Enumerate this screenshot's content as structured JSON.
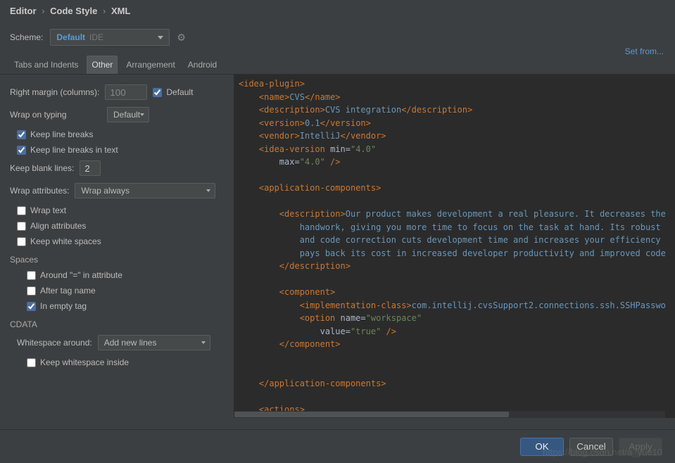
{
  "breadcrumb": {
    "p1": "Editor",
    "p2": "Code Style",
    "p3": "XML"
  },
  "scheme": {
    "label": "Scheme:",
    "name": "Default",
    "ide": "IDE"
  },
  "set_from": "Set from...",
  "tabs": {
    "t1": "Tabs and Indents",
    "t2": "Other",
    "t3": "Arrangement",
    "t4": "Android"
  },
  "left": {
    "right_margin_label": "Right margin (columns):",
    "right_margin_value": "100",
    "default_chk": "Default",
    "wrap_typing_label": "Wrap on typing",
    "wrap_typing_value": "Default",
    "keep_line_breaks": "Keep line breaks",
    "keep_line_breaks_text": "Keep line breaks in text",
    "keep_blank_label": "Keep blank lines:",
    "keep_blank_value": "2",
    "wrap_attrs_label": "Wrap attributes:",
    "wrap_attrs_value": "Wrap always",
    "wrap_text": "Wrap text",
    "align_attrs": "Align attributes",
    "keep_white": "Keep white spaces",
    "spaces_label": "Spaces",
    "around_eq": "Around \"=\" in attribute",
    "after_tag": "After tag name",
    "in_empty": "In empty tag",
    "cdata_label": "CDATA",
    "ws_around_label": "Whitespace around:",
    "ws_around_value": "Add new lines",
    "keep_ws_inside": "Keep whitespace inside"
  },
  "footer": {
    "ok": "OK",
    "cancel": "Cancel",
    "apply": "Apply"
  },
  "watermark": "https://blog.csdn.net/a_yue10",
  "code": {
    "name_val": "CVS",
    "desc_val": "CVS integration",
    "ver_val": "0.1",
    "vendor_val": "IntelliJ",
    "min_val": "\"4.0\"",
    "max_val": "\"4.0\"",
    "long_desc_1": "Our product makes development a real pleasure. It decreases the",
    "long_desc_2": "handwork, giving you more time to focus on the task at hand. Its robust",
    "long_desc_3": "and code correction cuts development time and increases your efficiency",
    "long_desc_4": "pays back its cost in increased developer productivity and improved code",
    "impl_class": "com.intellij.cvsSupport2.connections.ssh.SSHPasswo",
    "opt_name": "\"workspace\"",
    "opt_val": "\"true\""
  }
}
